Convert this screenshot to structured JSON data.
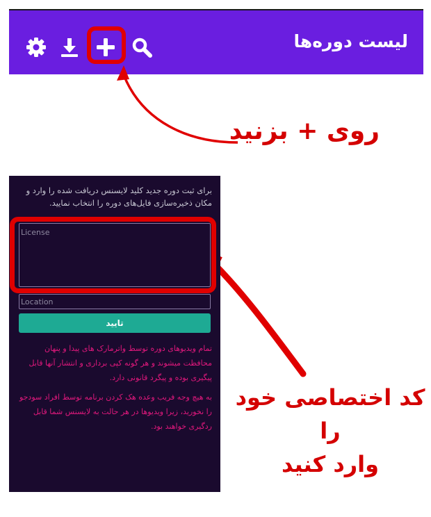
{
  "appbar": {
    "title": "لیست دوره‌ها",
    "icons": [
      "search-icon",
      "add-icon",
      "download-icon",
      "gear-icon"
    ],
    "background": "#6a1ee0"
  },
  "annotations": {
    "step1": "روی + بزنید",
    "step2_line1": "کد اختصاصی خود را",
    "step2_line2": "وارد کنید",
    "highlight_color": "#e00000"
  },
  "panel": {
    "background": "#1a0a2e",
    "intro": "برای ثبت دوره جدید کلید لایسنس دریافت شده را وارد و مکان ذخیره‌سازی فایل‌های دوره را انتخاب نمایید.",
    "license_placeholder": "License",
    "location_placeholder": "Location",
    "confirm_label": "تایید",
    "confirm_color": "#1eaa94",
    "warning_1": "تمام ویدیوهای دوره توسط واترمارک های پیدا و پنهان محافظت میشوند و هر گونه کپی برداری و انتشار آنها قابل پیگیری بوده و پیگرد قانونی دارد.",
    "warning_2": "به هیچ وجه فریب وعده هک کردن برنامه توسط افراد سودجو را نخورید، زیرا ویدیوها در هر حالت به لایسنس شما قابل ردگیری خواهند بود.",
    "warning_color": "#e0187c"
  }
}
